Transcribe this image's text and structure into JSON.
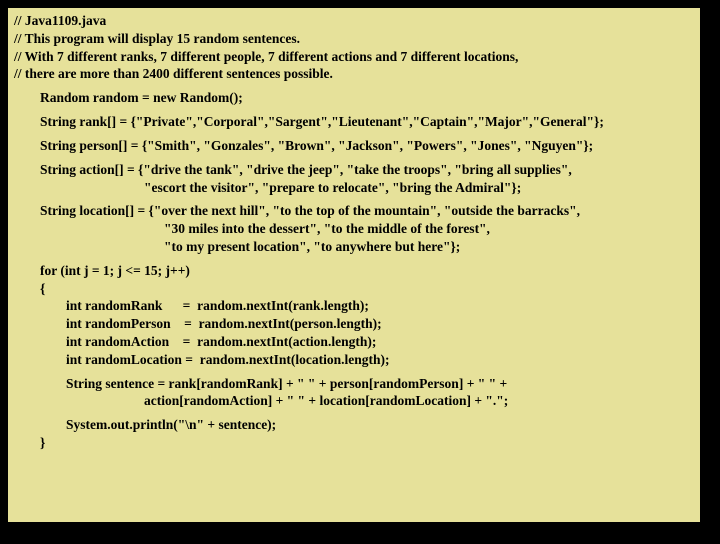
{
  "c1": "// Java1109.java",
  "c2": "// This program will display 15 random sentences.",
  "c3": "// With 7 different ranks, 7 different people, 7 different actions and 7 different locations,",
  "c4": "// there are more than 2400 different sentences possible.",
  "l1": "Random random = new Random();",
  "l2": "String rank[] = {\"Private\",\"Corporal\",\"Sargent\",\"Lieutenant\",\"Captain\",\"Major\",\"General\"};",
  "l3": "String person[] = {\"Smith\", \"Gonzales\", \"Brown\", \"Jackson\", \"Powers\", \"Jones\", \"Nguyen\"};",
  "l4a": "String action[] = {\"drive the tank\", \"drive the jeep\", \"take the troops\", \"bring all supplies\",",
  "l4b": "\"escort the visitor\", \"prepare to relocate\", \"bring the Admiral\"};",
  "l5a": "String location[] = {\"over the next hill\", \"to the top of the mountain\", \"outside the barracks\",",
  "l5b": "\"30 miles into the dessert\", \"to the middle of the forest\",",
  "l5c": "\"to my present location\", \"to anywhere but here\"};",
  "f1": "for (int j = 1; j <= 15; j++)",
  "f2": "{",
  "f3": "int randomRank      =  random.nextInt(rank.length);",
  "f4": "int randomPerson    =  random.nextInt(person.length);",
  "f5": "int randomAction    =  random.nextInt(action.length);",
  "f6": "int randomLocation =  random.nextInt(location.length);",
  "s1": "String sentence = rank[randomRank] + \" \" + person[randomPerson] + \" \" +",
  "s2": "action[randomAction] + \" \" + location[randomLocation] + \".\";",
  "p1": "System.out.println(\"\\n\" + sentence);",
  "f7": "}"
}
